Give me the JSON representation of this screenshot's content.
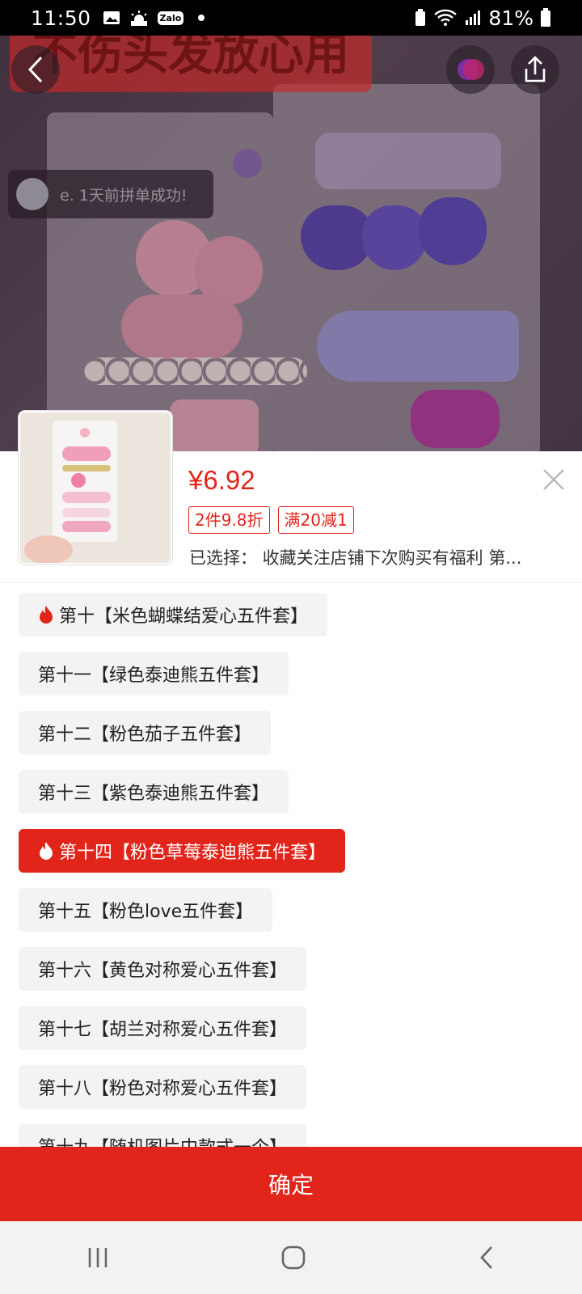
{
  "status_bar": {
    "time": "11:50",
    "zalo": "Zalo",
    "battery": "81%"
  },
  "hero": {
    "banner_text": "不伤头发放心用",
    "toast_text": "e. 1天前拼单成功!"
  },
  "product": {
    "price": "¥6.92",
    "tags": [
      "2件9.8折",
      "满20减1"
    ],
    "selected_text": "已选择：  收藏关注店铺下次购买有福利 第..."
  },
  "options": [
    {
      "label": "第十【米色蝴蝶结爱心五件套】",
      "hot": true,
      "active": false
    },
    {
      "label": "第十一【绿色泰迪熊五件套】",
      "hot": false,
      "active": false
    },
    {
      "label": "第十二【粉色茄子五件套】",
      "hot": false,
      "active": false
    },
    {
      "label": "第十三【紫色泰迪熊五件套】",
      "hot": false,
      "active": false
    },
    {
      "label": "第十四【粉色草莓泰迪熊五件套】",
      "hot": true,
      "active": true
    },
    {
      "label": "第十五【粉色love五件套】",
      "hot": false,
      "active": false
    },
    {
      "label": "第十六【黄色对称爱心五件套】",
      "hot": false,
      "active": false
    },
    {
      "label": "第十七【胡兰对称爱心五件套】",
      "hot": false,
      "active": false
    },
    {
      "label": "第十八【粉色对称爱心五件套】",
      "hot": false,
      "active": false
    },
    {
      "label": "第十九【随机图片中款式一个】",
      "hot": false,
      "active": false
    }
  ],
  "confirm_label": "确定",
  "colors": {
    "accent": "#e1251b",
    "chip_bg": "#f3f3f3"
  }
}
